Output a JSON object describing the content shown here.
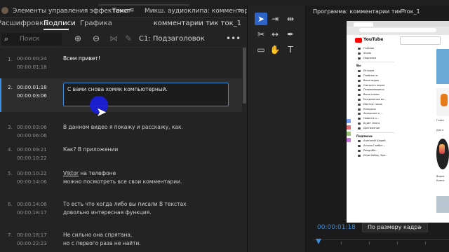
{
  "left_panel": {
    "tabs": {
      "effects": "Элементы управления эффектами",
      "text": "Текст",
      "mixer": "Микш. аудиоклипа: комментарии тик ток_1"
    },
    "subtabs": [
      "Расшифровка",
      "Подписи",
      "Графика"
    ],
    "sequence_name": "комментарии тик ток_1",
    "toolbar": {
      "search_placeholder": "Поиск",
      "caption_style": "C1: Подзаголовок"
    },
    "rows": [
      {
        "num": "1.",
        "in": "00:00:00:24",
        "out": "00:00:01:18",
        "text": "Всем привет!"
      },
      {
        "num": "2.",
        "in": "00:00:01:18",
        "out": "00:00:03:06",
        "text": "С вами снова хомяк компьютерный."
      },
      {
        "num": "3.",
        "in": "00:00:03:06",
        "out": "00:00:06:06",
        "text": "В данном видео я покажу и расскажу, как."
      },
      {
        "num": "4.",
        "in": "00:00:09:21",
        "out": "00:00:10:22",
        "text": "Как? В приложении"
      },
      {
        "num": "5.",
        "in": "00:00:10:22",
        "out": "00:00:14:06",
        "text_a": "Viktor",
        "text_b": " на телефоне",
        "text2": "можно посмотреть все свои комментарии."
      },
      {
        "num": "6.",
        "in": "00:00:14:06",
        "out": "00:00:18:17",
        "text": "То есть что когда либо вы писали В текстах",
        "text2": "довольно интересная функция."
      },
      {
        "num": "7.",
        "in": "00:00:18:17",
        "out": "00:00:22:23",
        "text": "Не сильно она спрятана,",
        "text2": "но с первого раза не найти."
      }
    ]
  },
  "program": {
    "title": "Программа: комментарии тик ток_1",
    "timecode": "00:00:01:18",
    "fit": "По размеру кадра"
  },
  "video": {
    "brand": "YouTube",
    "sidebar_top": [
      "Главная",
      "Shorts",
      "Подписки"
    ],
    "you_header": "Вы",
    "sidebar_you": [
      "История",
      "Плейлисты",
      "Ваши видео",
      "Смотреть позже",
      "Понравившиеся",
      "Ваши клипы"
    ],
    "sidebar_playlists": [
      "Ежедневные вл...",
      "Монтаж тиков",
      "Конкурсы",
      "Хакерские и ...",
      "Новости и...",
      "Будет много",
      "Достижения"
    ],
    "subs_header": "Подписки",
    "subs": [
      "Анатолий Шарий",
      "Антоха Гамбит...",
      "PalaguBlo...",
      "Игры Кибер, Эро..."
    ],
    "right_labels": [
      "Главн",
      "Для в",
      "Видео",
      "Компь"
    ]
  },
  "colors": {
    "accent": "#3d8bd6",
    "selection_blob": "#1a1fd6",
    "tool_active": "#2f64c7",
    "youtube_red": "#ff0000"
  }
}
